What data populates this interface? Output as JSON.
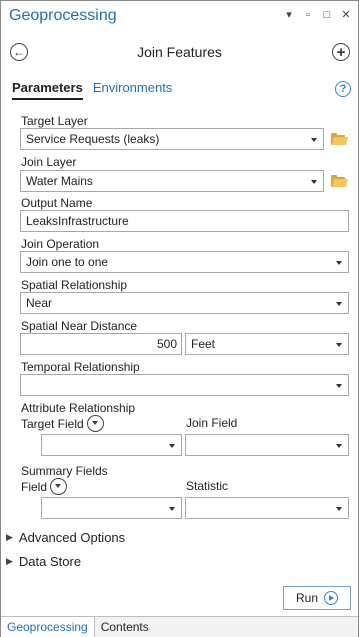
{
  "window": {
    "title": "Geoprocessing",
    "icons": [
      "menu-down-icon",
      "pin-icon",
      "maximize-icon",
      "close-icon"
    ]
  },
  "header": {
    "tool_title": "Join Features"
  },
  "tabs": [
    {
      "label": "Parameters",
      "active": true
    },
    {
      "label": "Environments",
      "active": false
    }
  ],
  "params": {
    "target_layer": {
      "label": "Target Layer",
      "value": "Service Requests (leaks)"
    },
    "join_layer": {
      "label": "Join Layer",
      "value": "Water Mains"
    },
    "output_name": {
      "label": "Output Name",
      "value": "LeaksInfrastructure"
    },
    "join_operation": {
      "label": "Join Operation",
      "value": "Join one to one"
    },
    "spatial_relationship": {
      "label": "Spatial Relationship",
      "value": "Near"
    },
    "spatial_near_distance": {
      "label": "Spatial Near Distance",
      "value": "500",
      "unit": "Feet"
    },
    "temporal_relationship": {
      "label": "Temporal Relationship",
      "value": ""
    },
    "attribute_relationship": {
      "label": "Attribute Relationship",
      "target_field_label": "Target Field",
      "join_field_label": "Join Field",
      "target_field_value": "",
      "join_field_value": ""
    },
    "summary_fields": {
      "label": "Summary Fields",
      "field_label": "Field",
      "statistic_label": "Statistic",
      "field_value": "",
      "statistic_value": ""
    }
  },
  "sections": {
    "advanced_options": "Advanced Options",
    "data_store": "Data Store"
  },
  "run_label": "Run",
  "bottom_tabs": [
    {
      "label": "Geoprocessing",
      "active": true
    },
    {
      "label": "Contents",
      "active": false
    }
  ],
  "colors": {
    "accent": "#1f6fb5",
    "folder": "#f2c85b"
  }
}
